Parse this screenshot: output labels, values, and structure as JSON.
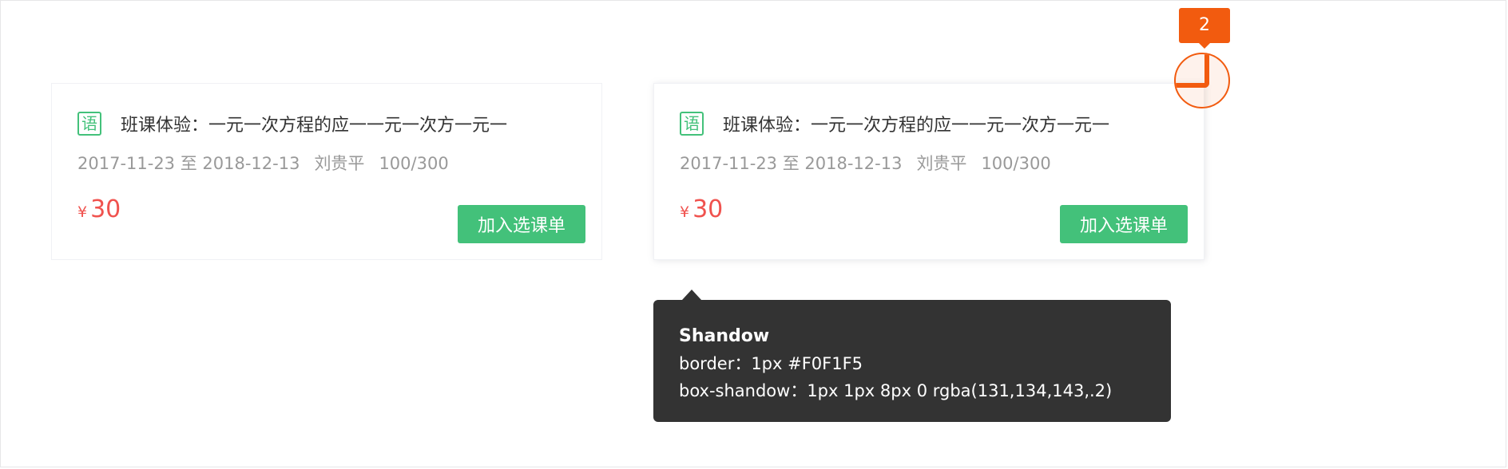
{
  "cards": [
    {
      "subject_icon": "语",
      "title": "班课体验：一元一次方程的应一一元一次方一元一",
      "date_range": "2017-11-23 至 2018-12-13",
      "teacher": "刘贵平",
      "enrollment": "100/300",
      "currency": "¥",
      "price": "30",
      "button_label": "加入选课单"
    },
    {
      "subject_icon": "语",
      "title": "班课体验：一元一次方程的应一一元一次方一元一",
      "date_range": "2017-11-23 至 2018-12-13",
      "teacher": "刘贵平",
      "enrollment": "100/300",
      "currency": "¥",
      "price": "30",
      "button_label": "加入选课单"
    }
  ],
  "marker": {
    "number": "2"
  },
  "tooltip": {
    "title": "Shandow",
    "line1": "border：1px  #F0F1F5",
    "line2": "box-shandow：1px 1px 8px 0 rgba(131,134,143,.2)"
  },
  "colors": {
    "accent_green": "#43C17A",
    "price_red": "#F0524E",
    "marker_orange": "#F25B0F",
    "tooltip_bg": "#333333",
    "card_border": "#F0F1F5"
  }
}
